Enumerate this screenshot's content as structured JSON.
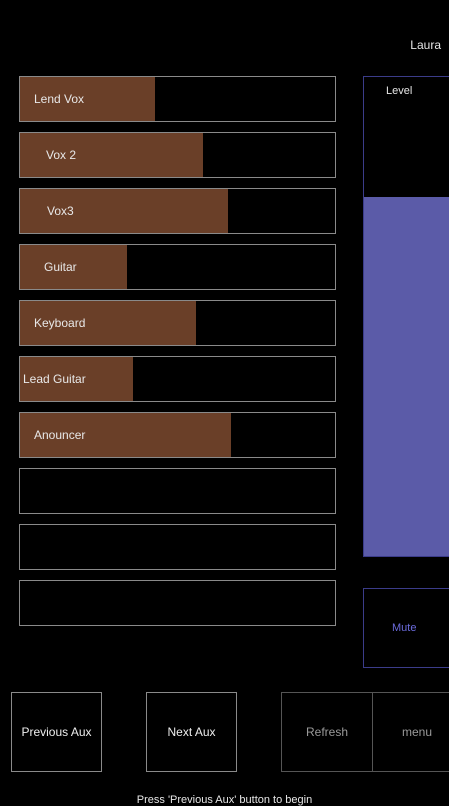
{
  "header": {
    "user_name": "Laura"
  },
  "channels": [
    {
      "label": "Lend Vox",
      "level": 0.43
    },
    {
      "label": "Vox 2",
      "level": 0.58
    },
    {
      "label": "Vox3",
      "level": 0.66
    },
    {
      "label": "Guitar",
      "level": 0.34
    },
    {
      "label": "Keyboard",
      "level": 0.56
    },
    {
      "label": "Lead Guitar",
      "level": 0.36
    },
    {
      "label": "Anouncer",
      "level": 0.67
    },
    {
      "label": "",
      "level": 0
    },
    {
      "label": "",
      "level": 0
    },
    {
      "label": "",
      "level": 0
    }
  ],
  "level_panel": {
    "title": "Level",
    "value": 0.75
  },
  "mute": {
    "label": "Mute"
  },
  "footer_buttons": {
    "previous_aux": "Previous Aux",
    "next_aux": "Next Aux",
    "refresh": "Refresh",
    "menu": "menu"
  },
  "status": {
    "message": "Press 'Previous Aux' button to begin"
  },
  "colors": {
    "background": "#000000",
    "channel_fill": "#6a3f28",
    "level_fill": "#5b5ba8",
    "mute_text": "#6b6bdc"
  }
}
